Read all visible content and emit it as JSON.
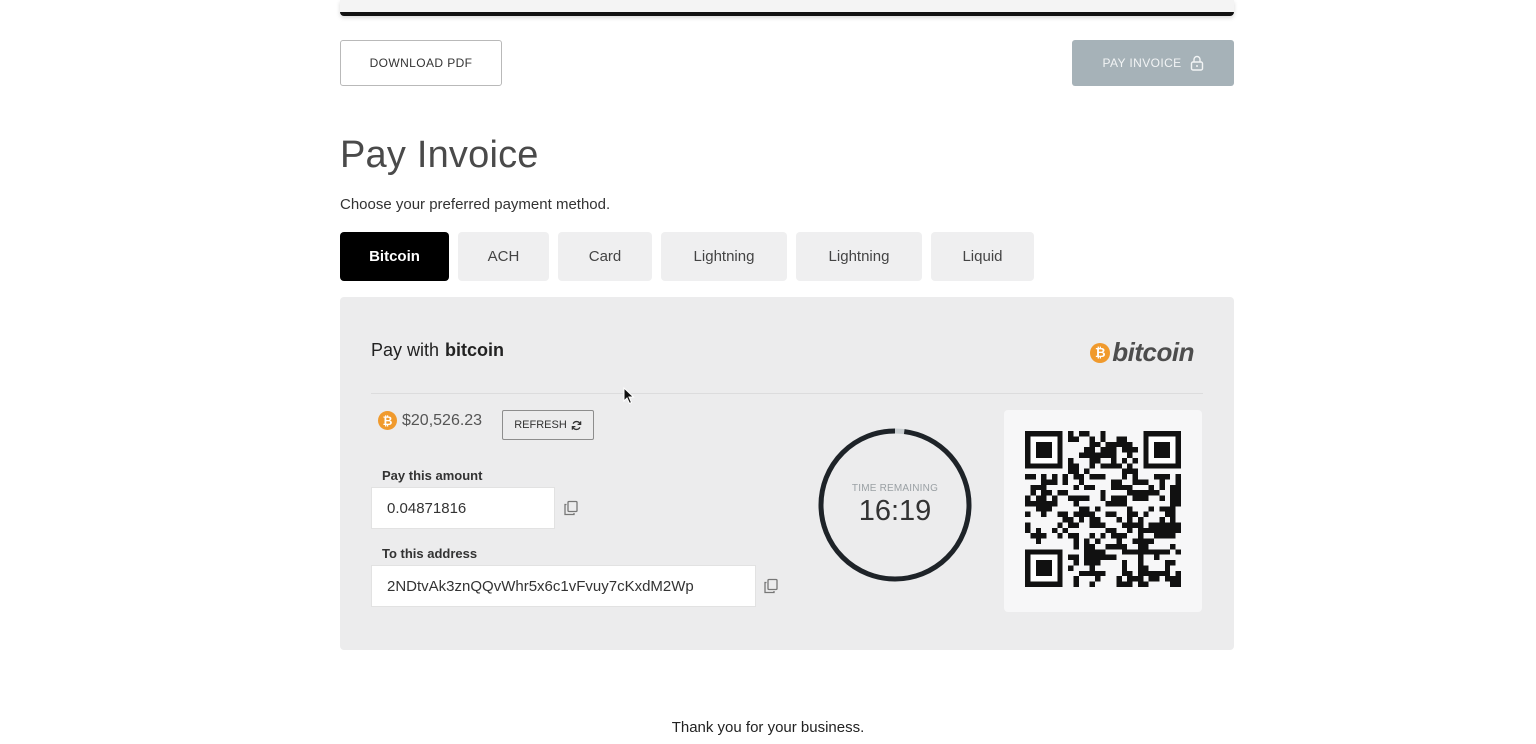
{
  "actions": {
    "download_label": "DOWNLOAD PDF",
    "pay_label": "PAY INVOICE"
  },
  "header": {
    "title": "Pay Invoice",
    "subtitle": "Choose your preferred payment method."
  },
  "tabs": [
    {
      "label": "Bitcoin",
      "active": true
    },
    {
      "label": "ACH",
      "active": false
    },
    {
      "label": "Card",
      "active": false
    },
    {
      "label": "Lightning",
      "active": false
    },
    {
      "label": "Lightning",
      "active": false
    },
    {
      "label": "Liquid",
      "active": false
    }
  ],
  "panel": {
    "pay_with_prefix": "Pay with",
    "pay_with_method": "bitcoin",
    "brand_word": "bitcoin",
    "brand_symbol": "₿",
    "price": "$20,526.23",
    "refresh_label": "REFRESH",
    "amount_label": "Pay this amount",
    "amount_value": "0.04871816",
    "address_label": "To this address",
    "address_value": "2NDtvAk3znQQvWhr5x6c1vFvuy7cKxdM2Wp",
    "timer_label": "TIME REMAINING",
    "timer_value": "16:19",
    "timer_remaining_fraction": 0.98
  },
  "footer": {
    "thanks": "Thank you for your business."
  },
  "colors": {
    "bitcoin_orange": "#f09a2d",
    "pay_button": "#a6b2b8",
    "panel_bg": "#ececed",
    "active_tab": "#000000"
  },
  "icons": [
    "lock-icon",
    "bitcoin-icon",
    "refresh-icon",
    "copy-icon",
    "qr-code"
  ]
}
